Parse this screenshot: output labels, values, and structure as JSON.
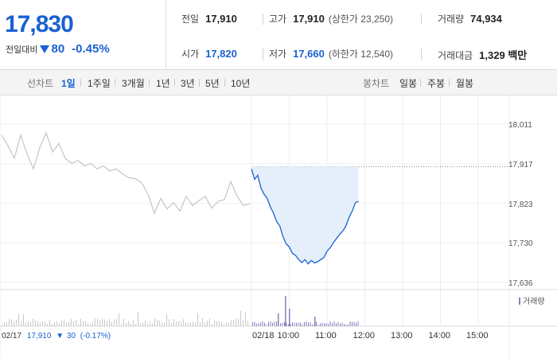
{
  "quote": {
    "price": "17,830",
    "change_label": "전일대비",
    "change_abs": "80",
    "change_pct": "-0.45%",
    "prev_close_label": "전일",
    "prev_close": "17,910",
    "high_label": "고가",
    "high": "17,910",
    "upper_limit": "(상한가 23,250)",
    "volume_label": "거래량",
    "volume": "74,934",
    "open_label": "시가",
    "open": "17,820",
    "low_label": "저가",
    "low": "17,660",
    "lower_limit": "(하한가 12,540)",
    "trade_value_label": "거래대금",
    "trade_value": "1,329 백만"
  },
  "periods": {
    "title": "선차트",
    "items": [
      "1일",
      "1주일",
      "3개월",
      "1년",
      "3년",
      "5년",
      "10년"
    ],
    "active": "1일"
  },
  "candles": {
    "title": "봉차트",
    "items": [
      "일봉",
      "주봉",
      "월봉"
    ]
  },
  "colors": {
    "accent": "#1a61d2",
    "down": "#1a61d2",
    "prev_day_line": "#c4c4c4",
    "today_fill": "#e5effb",
    "volume_today": "#8a7dc0",
    "volume_prev": "#c8c8c8"
  },
  "chart_data": {
    "type": "line",
    "y_ticks": [
      "18,011",
      "17,917",
      "17,823",
      "17,730",
      "17,636"
    ],
    "ylim": [
      17636,
      18011
    ],
    "prev_close_ref": 17910,
    "volume_legend": "거래량",
    "prev_day_info": {
      "date": "02/17",
      "close": "17,910",
      "change": "30",
      "change_pct": "(-0.17%)"
    },
    "x_ticks": [
      "02/18",
      "10:00",
      "11:00",
      "12:00",
      "13:00",
      "14:00",
      "15:00"
    ],
    "series": [
      {
        "values_prev_day": [
          17985,
          17960,
          17930,
          17985,
          17940,
          17905,
          17955,
          17990,
          17945,
          17965,
          17930,
          17918,
          17925,
          17912,
          17918,
          17905,
          17912,
          17900,
          17905,
          17893,
          17884,
          17882,
          17872,
          17845,
          17800,
          17835,
          17810,
          17825,
          17805,
          17840,
          17818,
          17830,
          17840,
          17812,
          17828,
          17832,
          17875,
          17840,
          17818,
          17823
        ]
      },
      {
        "times": [
          "09:00",
          "09:05",
          "09:10",
          "09:15",
          "09:20",
          "09:25",
          "09:30",
          "09:35",
          "09:40",
          "09:45",
          "09:50",
          "09:55",
          "10:00",
          "10:05",
          "10:10",
          "10:15",
          "10:20",
          "10:25",
          "10:30",
          "10:35",
          "10:40",
          "10:45",
          "10:50",
          "10:55",
          "11:00",
          "11:05",
          "11:10",
          "11:15",
          "11:20",
          "11:25",
          "11:30",
          "11:35",
          "11:40",
          "11:45",
          "11:50"
        ],
        "values": [
          17905,
          17880,
          17890,
          17860,
          17845,
          17835,
          17815,
          17800,
          17780,
          17770,
          17745,
          17728,
          17720,
          17705,
          17700,
          17690,
          17683,
          17690,
          17680,
          17688,
          17682,
          17685,
          17690,
          17695,
          17710,
          17718,
          17730,
          17740,
          17750,
          17758,
          17770,
          17790,
          17805,
          17825,
          17828
        ]
      }
    ]
  }
}
